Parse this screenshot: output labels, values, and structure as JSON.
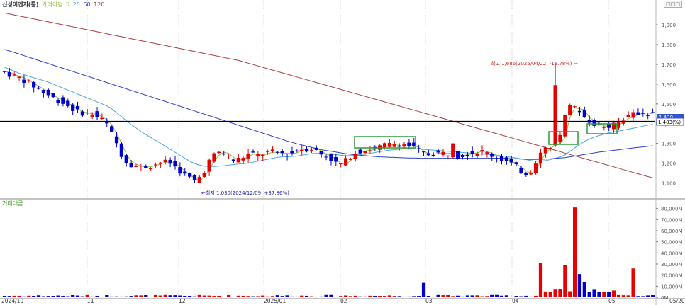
{
  "header": {
    "stock_name": "신성이엔지(통)",
    "ma_label": "가격이평",
    "ma_periods": [
      "5",
      "20",
      "60",
      "120"
    ],
    "ma_colors": [
      "#8fbf3f",
      "#4aa8e0",
      "#2b3fc4",
      "#a64040"
    ]
  },
  "volume_header": {
    "label": "거래대금"
  },
  "colors": {
    "up": "#e60000",
    "down": "#0000cc"
  },
  "chart_data": [
    {
      "type": "candlestick",
      "ylim": [
        1030,
        1990
      ],
      "y_ticks": [
        "1,900",
        "1,800",
        "1,700",
        "1,600",
        "1,500",
        "1,400",
        "1,300",
        "1,200",
        "1,100"
      ],
      "x_ticks": [
        "2024/10",
        "11",
        "12",
        "2025/01",
        "02",
        "03",
        "04",
        "05",
        "05/20"
      ],
      "current_price_label": "1,403",
      "current_price_suffix": "(%)",
      "right_marker_label": "1,430",
      "max_annotation": "최고 1,686(2025/04/22, -15.78%)",
      "min_annotation": "최저 1,030(2024/12/09, +37.86%)",
      "max": 1686,
      "min": 1030,
      "horizontal_line": 1410,
      "series": [
        {
          "name": "5",
          "values": [
            1665,
            1660,
            1650,
            1640,
            1632,
            1620,
            1605,
            1590,
            1575,
            1560,
            1545,
            1530,
            1520,
            1505,
            1490,
            1475,
            1460,
            1455,
            1450,
            1448,
            1435,
            1420,
            1395,
            1350,
            1300,
            1245,
            1210,
            1195,
            1185,
            1180,
            1182,
            1188,
            1195,
            1205,
            1205,
            1200,
            1182,
            1160,
            1140,
            1125,
            1110,
            1130,
            1165,
            1210,
            1240,
            1255,
            1250,
            1230,
            1215,
            1220,
            1232,
            1245,
            1245,
            1240,
            1248,
            1255,
            1255,
            1252,
            1250,
            1248,
            1252,
            1265,
            1272,
            1272,
            1275,
            1262,
            1245,
            1238,
            1220,
            1200,
            1195,
            1212,
            1235,
            1255,
            1262,
            1265,
            1270,
            1275,
            1282,
            1290,
            1294,
            1296,
            1298,
            1295,
            1290,
            1278,
            1262,
            1248,
            1245,
            1250,
            1250,
            1250,
            1250,
            1245,
            1238,
            1242,
            1248,
            1252,
            1260,
            1258,
            1250,
            1240,
            1230,
            1220,
            1210,
            1196,
            1180,
            1162,
            1148,
            1160,
            1210,
            1250,
            1275,
            1290,
            1300,
            1330,
            1430,
            1480,
            1475,
            1470,
            1430,
            1415,
            1400,
            1390,
            1385,
            1383,
            1390,
            1410,
            1425,
            1436,
            1445,
            1452,
            1455,
            1450
          ]
        },
        {
          "name": "20",
          "values": [
            1685,
            1675,
            1665,
            1655,
            1648,
            1640,
            1632,
            1625,
            1618,
            1610,
            1600,
            1590,
            1580,
            1570,
            1560,
            1550,
            1540,
            1530,
            1520,
            1510,
            1500,
            1490,
            1475,
            1455,
            1435,
            1415,
            1395,
            1378,
            1360,
            1345,
            1330,
            1315,
            1300,
            1285,
            1270,
            1255,
            1240,
            1225,
            1210,
            1198,
            1190,
            1185,
            1183,
            1183,
            1185,
            1187,
            1190,
            1193,
            1196,
            1198,
            1200,
            1205,
            1210,
            1215,
            1220,
            1225,
            1230,
            1232,
            1233,
            1234,
            1236,
            1240,
            1244,
            1248,
            1250,
            1250,
            1248,
            1245,
            1243,
            1240,
            1238,
            1238,
            1240,
            1243,
            1246,
            1250,
            1254,
            1258,
            1262,
            1266,
            1268,
            1270,
            1272,
            1273,
            1273,
            1272,
            1270,
            1268,
            1266,
            1264,
            1262,
            1260,
            1258,
            1256,
            1254,
            1252,
            1250,
            1248,
            1246,
            1244,
            1242,
            1240,
            1237,
            1234,
            1230,
            1226,
            1222,
            1218,
            1213,
            1210,
            1210,
            1213,
            1218,
            1225,
            1232,
            1242,
            1260,
            1278,
            1295,
            1310,
            1322,
            1332,
            1340,
            1347,
            1353,
            1358,
            1362,
            1367,
            1372,
            1377,
            1382,
            1387,
            1392,
            1396
          ]
        },
        {
          "name": "60",
          "values": [
            1775,
            1768,
            1760,
            1752,
            1744,
            1736,
            1728,
            1720,
            1712,
            1704,
            1696,
            1688,
            1680,
            1672,
            1664,
            1656,
            1648,
            1640,
            1632,
            1624,
            1616,
            1608,
            1600,
            1592,
            1584,
            1576,
            1568,
            1560,
            1552,
            1544,
            1536,
            1528,
            1520,
            1512,
            1504,
            1496,
            1488,
            1480,
            1472,
            1464,
            1456,
            1448,
            1440,
            1432,
            1424,
            1416,
            1408,
            1400,
            1392,
            1384,
            1376,
            1368,
            1360,
            1352,
            1344,
            1336,
            1328,
            1320,
            1312,
            1305,
            1298,
            1292,
            1286,
            1280,
            1274,
            1268,
            1264,
            1260,
            1256,
            1252,
            1248,
            1245,
            1242,
            1240,
            1238,
            1236,
            1234,
            1232,
            1231,
            1230,
            1229,
            1228,
            1227,
            1226,
            1226,
            1225,
            1225,
            1225,
            1225,
            1225,
            1225,
            1225,
            1225,
            1225,
            1225,
            1225,
            1225,
            1225,
            1225,
            1225,
            1225,
            1225,
            1225,
            1224,
            1223,
            1222,
            1221,
            1220,
            1219,
            1219,
            1220,
            1221,
            1222,
            1224,
            1226,
            1228,
            1232,
            1236,
            1240,
            1244,
            1248,
            1252,
            1256,
            1259,
            1262,
            1265,
            1268,
            1271,
            1274,
            1277,
            1280,
            1282,
            1285,
            1288
          ]
        },
        {
          "name": "120",
          "values": [
            1960,
            1955,
            1950,
            1945,
            1940,
            1935,
            1930,
            1925,
            1920,
            1915,
            1910,
            1905,
            1900,
            1895,
            1890,
            1885,
            1880,
            1875,
            1870,
            1865,
            1860,
            1855,
            1850,
            1845,
            1840,
            1835,
            1830,
            1825,
            1820,
            1815,
            1810,
            1805,
            1800,
            1795,
            1790,
            1785,
            1780,
            1775,
            1770,
            1765,
            1760,
            1755,
            1750,
            1745,
            1740,
            1735,
            1730,
            1725,
            1720,
            1713,
            1706,
            1699,
            1692,
            1685,
            1678,
            1671,
            1664,
            1657,
            1650,
            1643,
            1636,
            1629,
            1622,
            1615,
            1608,
            1601,
            1594,
            1587,
            1580,
            1573,
            1566,
            1559,
            1552,
            1545,
            1538,
            1531,
            1524,
            1517,
            1510,
            1503,
            1496,
            1489,
            1482,
            1475,
            1468,
            1461,
            1454,
            1447,
            1440,
            1433,
            1426,
            1419,
            1412,
            1405,
            1398,
            1391,
            1384,
            1377,
            1370,
            1363,
            1356,
            1349,
            1342,
            1335,
            1328,
            1321,
            1314,
            1307,
            1300,
            1293,
            1286,
            1279,
            1272,
            1265,
            1258,
            1251,
            1244,
            1237,
            1230,
            1223,
            1216,
            1209,
            1202,
            1195,
            1188,
            1181,
            1174,
            1167,
            1160,
            1153,
            1146,
            1139,
            1132,
            1125
          ]
        }
      ]
    },
    {
      "type": "bar",
      "title": "거래대금",
      "ylim": [
        0,
        83000
      ],
      "y_ticks": [
        "80,000M",
        "70,000M",
        "60,000M",
        "50,000M",
        "40,000M",
        "30,000M",
        "20,000M",
        "10,000M",
        "0M"
      ],
      "notable_bars": [
        {
          "date": "2025/02",
          "value": 13000
        },
        {
          "date": "2025/04",
          "value": 31000
        },
        {
          "date": "2025/04",
          "value": 29000
        },
        {
          "date": "2025/04/22",
          "value": 81000
        },
        {
          "date": "2025/05",
          "value": 21000
        },
        {
          "date": "2025/05",
          "value": 26000
        }
      ]
    }
  ]
}
